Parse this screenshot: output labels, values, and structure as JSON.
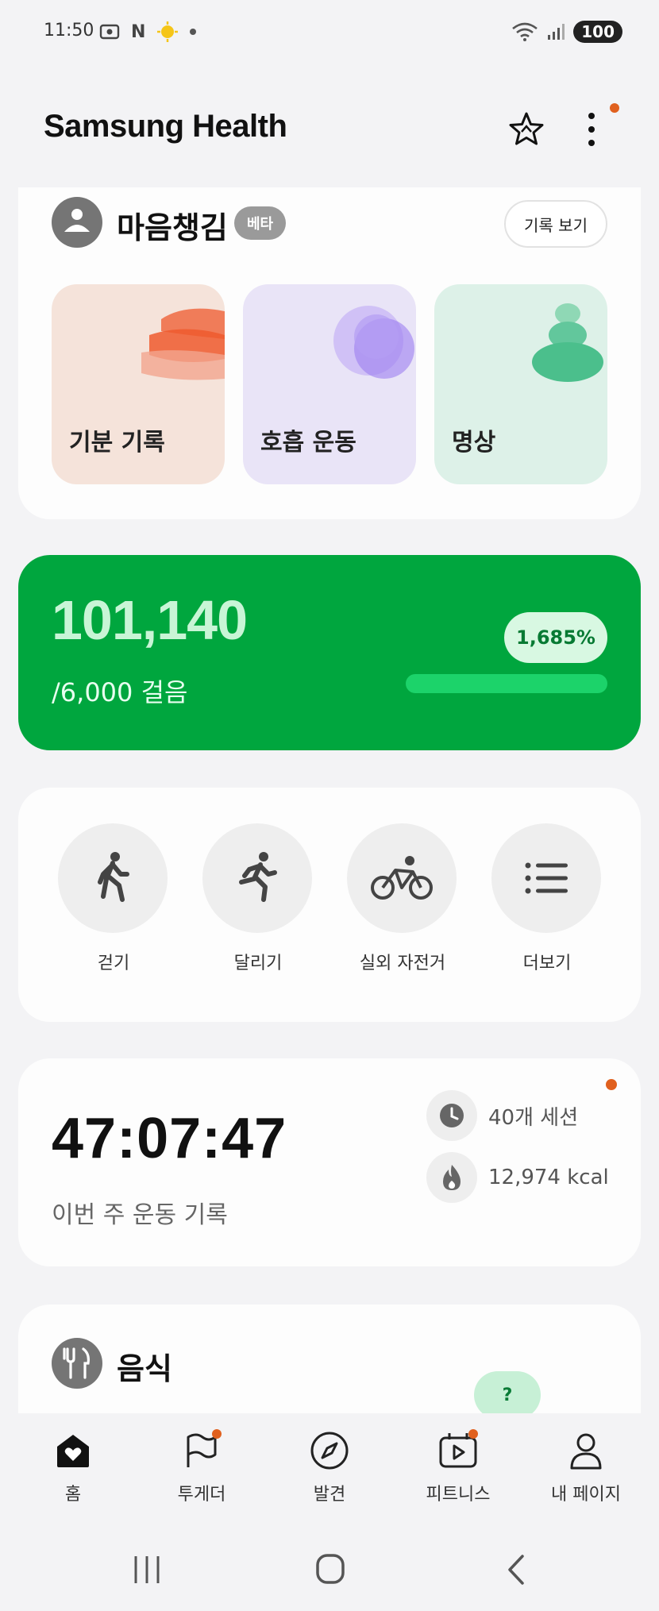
{
  "status_bar": {
    "time": "11:50",
    "battery": "100"
  },
  "header": {
    "title": "Samsung Health"
  },
  "mind": {
    "title": "마음챙김",
    "beta": "베타",
    "history_button": "기록 보기",
    "tiles": [
      "기분 기록",
      "호흡 운동",
      "명상"
    ]
  },
  "steps": {
    "count": "101,140",
    "goal": "/6,000 걸음",
    "percent_label": "1,685%",
    "progress_fraction": 1.0
  },
  "activities": [
    {
      "label": "걷기",
      "icon": "walking-icon"
    },
    {
      "label": "달리기",
      "icon": "running-icon"
    },
    {
      "label": "실외 자전거",
      "icon": "cycling-icon"
    },
    {
      "label": "더보기",
      "icon": "more-list-icon"
    }
  ],
  "weekly": {
    "time": "47:07:47",
    "label": "이번 주 운동 기록",
    "sessions": "40개 세션",
    "calories": "12,974 kcal"
  },
  "food": {
    "title": "음식",
    "help": "?"
  },
  "bottom_nav": [
    {
      "label": "홈",
      "icon": "home-icon"
    },
    {
      "label": "투게더",
      "icon": "flag-icon"
    },
    {
      "label": "발견",
      "icon": "compass-icon"
    },
    {
      "label": "피트니스",
      "icon": "fitness-video-icon"
    },
    {
      "label": "내 페이지",
      "icon": "profile-icon"
    }
  ],
  "colors": {
    "accent_green": "#00a63e",
    "notification_dot": "#e0601e",
    "tile_mood": "#f5e3da",
    "tile_breath": "#e9e4f7",
    "tile_meditation": "#ddf1e8"
  }
}
